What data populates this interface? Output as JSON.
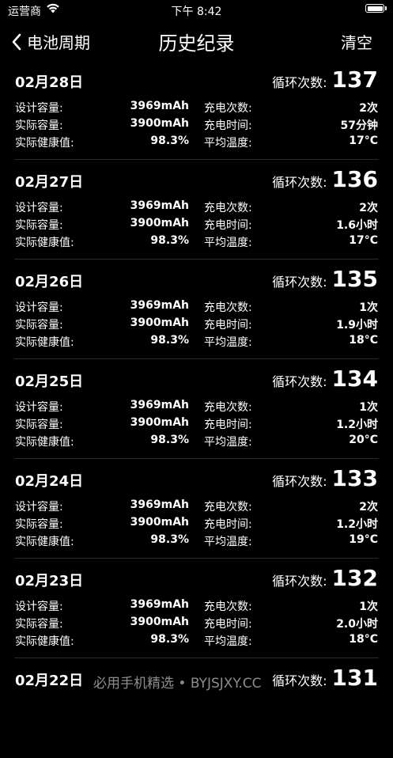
{
  "status_bar": {
    "carrier": "运营商",
    "time": "下午 8:42"
  },
  "nav": {
    "back_label": "电池周期",
    "title": "历史纪录",
    "right_label": "清空"
  },
  "labels": {
    "design_capacity": "设计容量:",
    "actual_capacity": "实际容量:",
    "health": "实际健康值:",
    "charge_count": "充电次数:",
    "charge_time": "充电时间:",
    "avg_temp": "平均温度:",
    "cycle_count": "循环次数:"
  },
  "records": [
    {
      "date": "02月28日",
      "cycle": "137",
      "design": "3969mAh",
      "actual": "3900mAh",
      "health": "98.3%",
      "count": "2次",
      "time": "57分钟",
      "temp": "17°C"
    },
    {
      "date": "02月27日",
      "cycle": "136",
      "design": "3969mAh",
      "actual": "3900mAh",
      "health": "98.3%",
      "count": "2次",
      "time": "1.6小时",
      "temp": "17°C"
    },
    {
      "date": "02月26日",
      "cycle": "135",
      "design": "3969mAh",
      "actual": "3900mAh",
      "health": "98.3%",
      "count": "1次",
      "time": "1.9小时",
      "temp": "18°C"
    },
    {
      "date": "02月25日",
      "cycle": "134",
      "design": "3969mAh",
      "actual": "3900mAh",
      "health": "98.3%",
      "count": "1次",
      "time": "1.2小时",
      "temp": "20°C"
    },
    {
      "date": "02月24日",
      "cycle": "133",
      "design": "3969mAh",
      "actual": "3900mAh",
      "health": "98.3%",
      "count": "2次",
      "time": "1.2小时",
      "temp": "19°C"
    },
    {
      "date": "02月23日",
      "cycle": "132",
      "design": "3969mAh",
      "actual": "3900mAh",
      "health": "98.3%",
      "count": "1次",
      "time": "2.0小时",
      "temp": "18°C"
    },
    {
      "date": "02月22日",
      "cycle": "131"
    }
  ],
  "watermark": "必用手机精选 • BYJSJXY.CC",
  "icons": {
    "wifi": "wifi-icon",
    "battery": "battery-icon",
    "back": "chevron-left-icon"
  }
}
